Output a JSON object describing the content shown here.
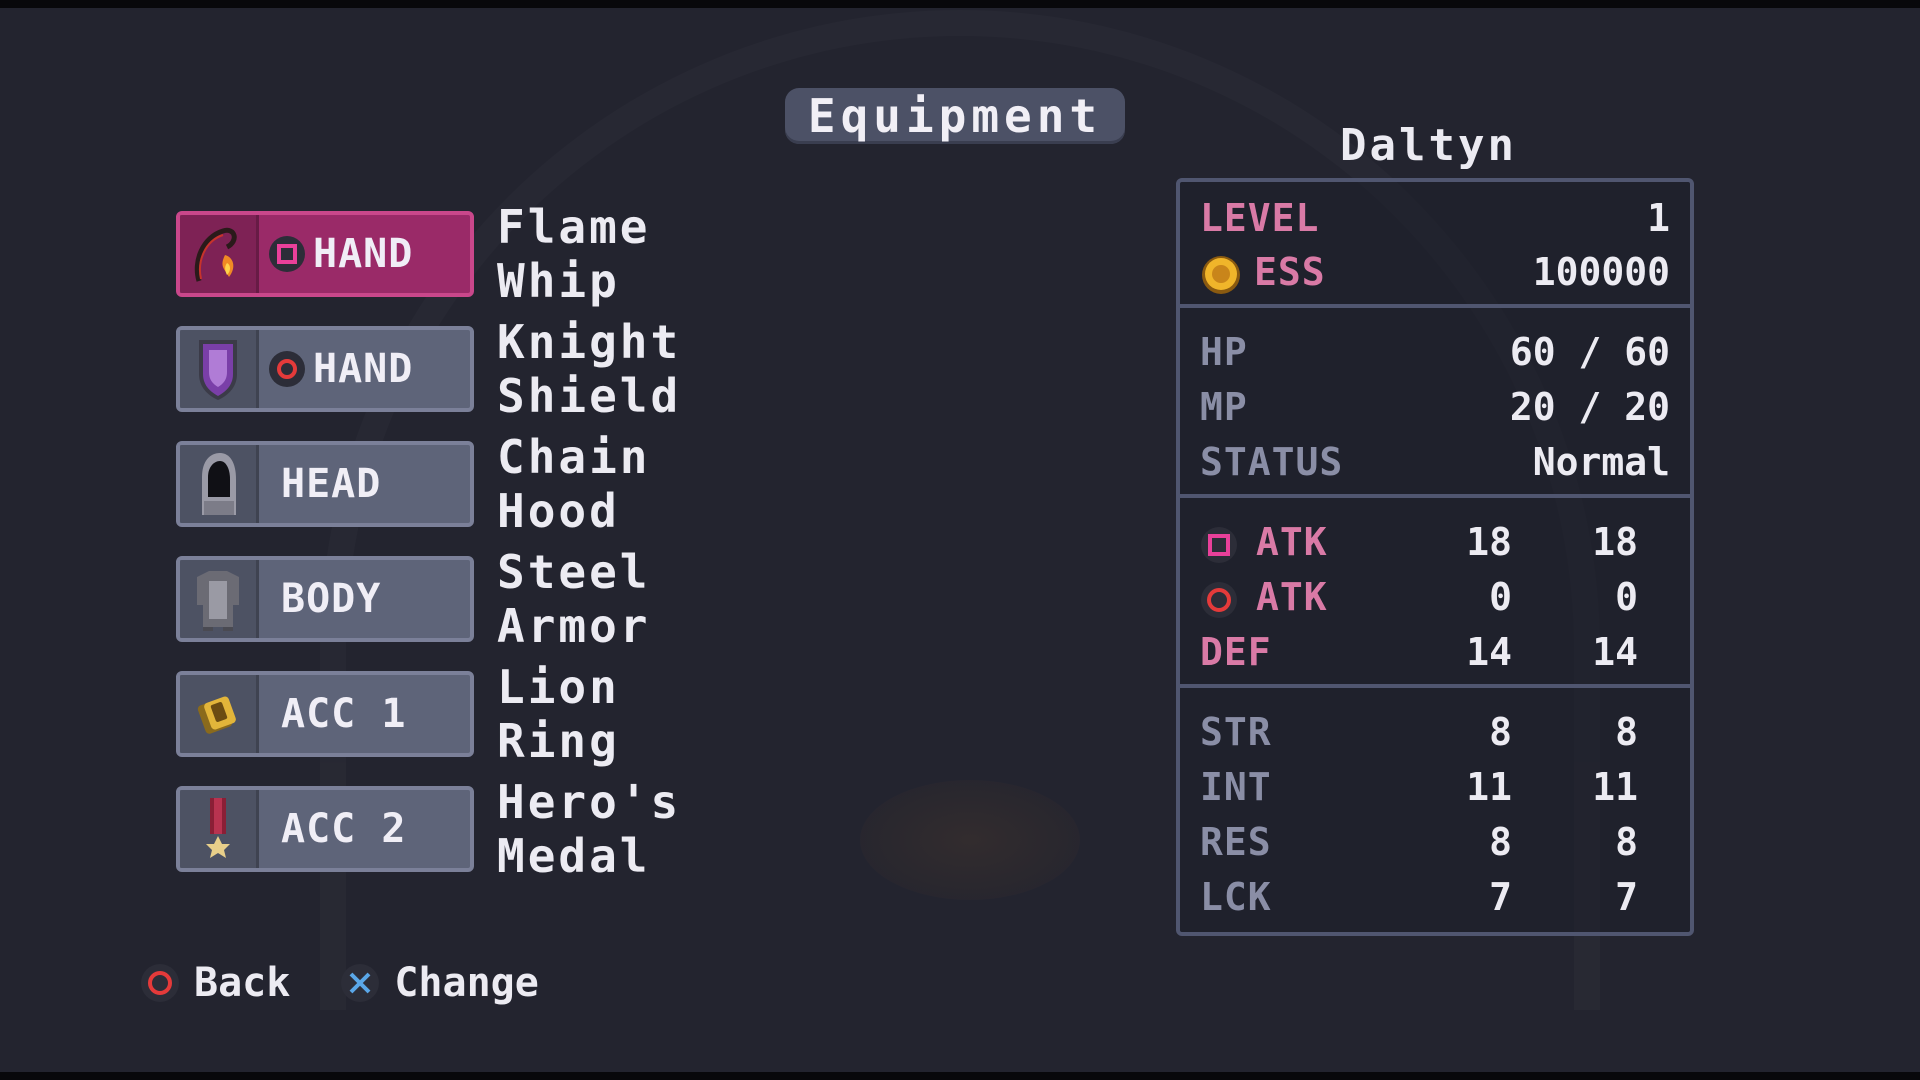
{
  "screen": {
    "title": "Equipment"
  },
  "slots": [
    {
      "label": "HAND",
      "item": "Flame Whip",
      "button": "square-button-icon",
      "icon": "flame-whip-icon",
      "selected": true
    },
    {
      "label": "HAND",
      "item": "Knight Shield",
      "button": "circle-button-icon",
      "icon": "knight-shield-icon",
      "selected": false
    },
    {
      "label": "HEAD",
      "item": "Chain Hood",
      "icon": "chain-hood-icon",
      "selected": false
    },
    {
      "label": "BODY",
      "item": "Steel Armor",
      "icon": "steel-armor-icon",
      "selected": false
    },
    {
      "label": "ACC 1",
      "item": "Lion Ring",
      "icon": "lion-ring-icon",
      "selected": false
    },
    {
      "label": "ACC 2",
      "item": "Hero's Medal",
      "icon": "heros-medal-icon",
      "selected": false
    }
  ],
  "character": {
    "name": "Daltyn",
    "level_label": "LEVEL",
    "level": "1",
    "ess_label": "ESS",
    "ess": "100000",
    "hp_label": "HP",
    "hp": "60 / 60",
    "mp_label": "MP",
    "mp": "20 / 20",
    "status_label": "STATUS",
    "status": "Normal",
    "combat": [
      {
        "label": "ATK",
        "button": "square-button-icon",
        "current": "18",
        "new": "18"
      },
      {
        "label": "ATK",
        "button": "circle-button-icon",
        "current": "0",
        "new": "0"
      },
      {
        "label": "DEF",
        "current": "14",
        "new": "14"
      }
    ],
    "attributes": [
      {
        "label": "STR",
        "current": "8",
        "new": "8"
      },
      {
        "label": "INT",
        "current": "11",
        "new": "11"
      },
      {
        "label": "RES",
        "current": "8",
        "new": "8"
      },
      {
        "label": "LCK",
        "current": "7",
        "new": "7"
      }
    ]
  },
  "footer": {
    "back_label": "Back",
    "change_label": "Change"
  },
  "colors": {
    "accent": "#9a2a68",
    "pink_label": "#d97aa6",
    "panel": "#5e6479",
    "background": "#23242f"
  }
}
